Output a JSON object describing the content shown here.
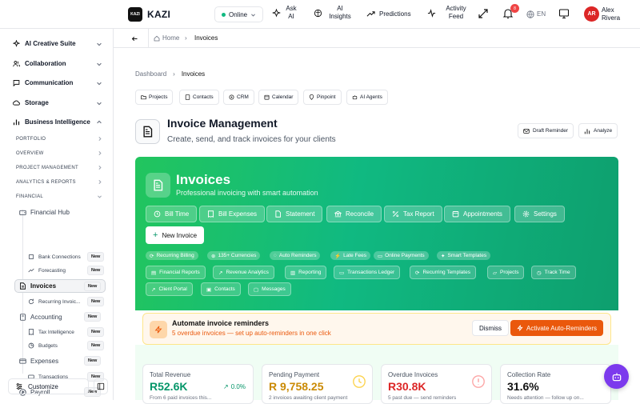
{
  "app": {
    "name": "KAZI",
    "logo_text": "KAZI"
  },
  "topbar": {
    "status": "Online",
    "nav": [
      {
        "label": "Ask AI"
      },
      {
        "label": "AI Insights"
      },
      {
        "label": "Predictions"
      },
      {
        "label": "Activity Feed"
      }
    ],
    "notification_count": "8",
    "language": "EN",
    "user": {
      "initials": "AR",
      "first": "Alex",
      "last": "Rivera"
    }
  },
  "sidebar": {
    "groups": [
      {
        "label": "AI Creative Suite"
      },
      {
        "label": "Collaboration"
      },
      {
        "label": "Communication"
      },
      {
        "label": "Storage"
      },
      {
        "label": "Business Intelligence"
      }
    ],
    "sections": [
      "PORTFOLIO",
      "OVERVIEW",
      "PROJECT MANAGEMENT",
      "ANALYTICS & REPORTS",
      "FINANCIAL"
    ],
    "items": [
      {
        "label": "Financial Hub"
      },
      {
        "label": "Bank Connections",
        "badge": "New"
      },
      {
        "label": "Forecasting",
        "badge": "New"
      },
      {
        "label": "Invoices",
        "badge": "New"
      },
      {
        "label": "Recurring Invoic...",
        "badge": "New"
      },
      {
        "label": "Accounting",
        "badge": "New"
      },
      {
        "label": "Tax Intelligence",
        "badge": "New"
      },
      {
        "label": "Budgets",
        "badge": "New"
      },
      {
        "label": "Expenses",
        "badge": "New"
      },
      {
        "label": "Transactions",
        "badge": "New"
      },
      {
        "label": "Payroll",
        "badge": "New"
      }
    ],
    "customize": "Customize"
  },
  "breadcrumb_bar": {
    "home": "Home",
    "current": "Invoices"
  },
  "page": {
    "crumb_parent": "Dashboard",
    "crumb_current": "Invoices",
    "quick_links": [
      "Projects",
      "Contacts",
      "CRM",
      "Calendar",
      "Pinpoint",
      "AI Agents"
    ],
    "title": "Invoice Management",
    "subtitle": "Create, send, and track invoices for your clients",
    "draft_reminder": "Draft Reminder",
    "analyze": "Analyze"
  },
  "hero": {
    "title": "Invoices",
    "subtitle": "Professional invoicing with smart automation",
    "actions": [
      "Bill Time",
      "Bill Expenses",
      "Statement",
      "Reconcile",
      "Tax Report",
      "Appointments",
      "Settings"
    ],
    "new_invoice": "New Invoice",
    "chips": [
      "Recurring Billing",
      "135+ Currencies",
      "Auto Reminders",
      "Late Fees",
      "Online Payments",
      "Smart Templates"
    ],
    "links_row1": [
      "Financial Reports",
      "Revenue Analytics",
      "Reporting",
      "Transactions Ledger",
      "Recurring Templates",
      "Projects",
      "Track Time"
    ],
    "links_row2": [
      "Client Portal",
      "Contacts",
      "Messages"
    ]
  },
  "alert": {
    "title": "Automate invoice reminders",
    "text": "5 overdue invoices — set up auto-reminders in one click",
    "dismiss": "Dismiss",
    "cta": "Activate Auto-Reminders"
  },
  "stats": [
    {
      "label": "Total Revenue",
      "value": "R52.6K",
      "change": "0.0%",
      "note": "From 6 paid invoices this..."
    },
    {
      "label": "Pending Payment",
      "value": "R 9,758.25",
      "note": "2 invoices awaiting client payment"
    },
    {
      "label": "Overdue Invoices",
      "value": "R30.8K",
      "note": "5 past due — send reminders"
    },
    {
      "label": "Collection Rate",
      "value": "31.6%",
      "note": "Needs attention — follow up on..."
    }
  ],
  "colors": {
    "accent": "#10b981",
    "danger": "#ef4444",
    "warning": "#ea580c",
    "alert_bg": "#fff7ed"
  }
}
